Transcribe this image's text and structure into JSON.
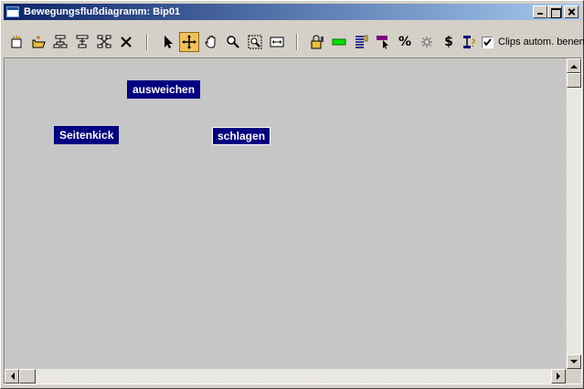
{
  "window": {
    "title": "Bewegungsflußdiagramm: Bip01"
  },
  "toolbar": {
    "tools": [
      {
        "name": "new-file-icon"
      },
      {
        "name": "open-file-icon"
      },
      {
        "name": "insert-tree-icon"
      },
      {
        "name": "append-tree-icon"
      },
      {
        "name": "insert-node-icon"
      },
      {
        "name": "delete-icon"
      },
      {
        "name": "select-arrow-icon"
      },
      {
        "name": "move-cross-icon",
        "active": true
      },
      {
        "name": "pan-hand-icon"
      },
      {
        "name": "zoom-magnifier-icon"
      },
      {
        "name": "zoom-region-icon"
      },
      {
        "name": "zoom-extents-icon"
      },
      {
        "name": "lock-icon"
      },
      {
        "name": "green-clip-icon"
      },
      {
        "name": "list-icon"
      },
      {
        "name": "purple-pointer-icon"
      },
      {
        "name": "percent-icon"
      },
      {
        "name": "cog-icon"
      },
      {
        "name": "dollar-icon"
      },
      {
        "name": "script-icon"
      }
    ],
    "percent_glyph": "%",
    "dollar_glyph": "$",
    "auto_clip_checked": true,
    "auto_clip_label": "Clips autom. benen"
  },
  "nodes": [
    {
      "label": "ausweichen",
      "selected": false
    },
    {
      "label": "Seitenkick",
      "selected": false
    },
    {
      "label": "schlagen",
      "selected": true
    }
  ],
  "colors": {
    "node_bg": "#000080",
    "canvas_bg": "#c6c6c6",
    "active_tool": "#f2c057",
    "title_gradient_start": "#0a246a"
  }
}
